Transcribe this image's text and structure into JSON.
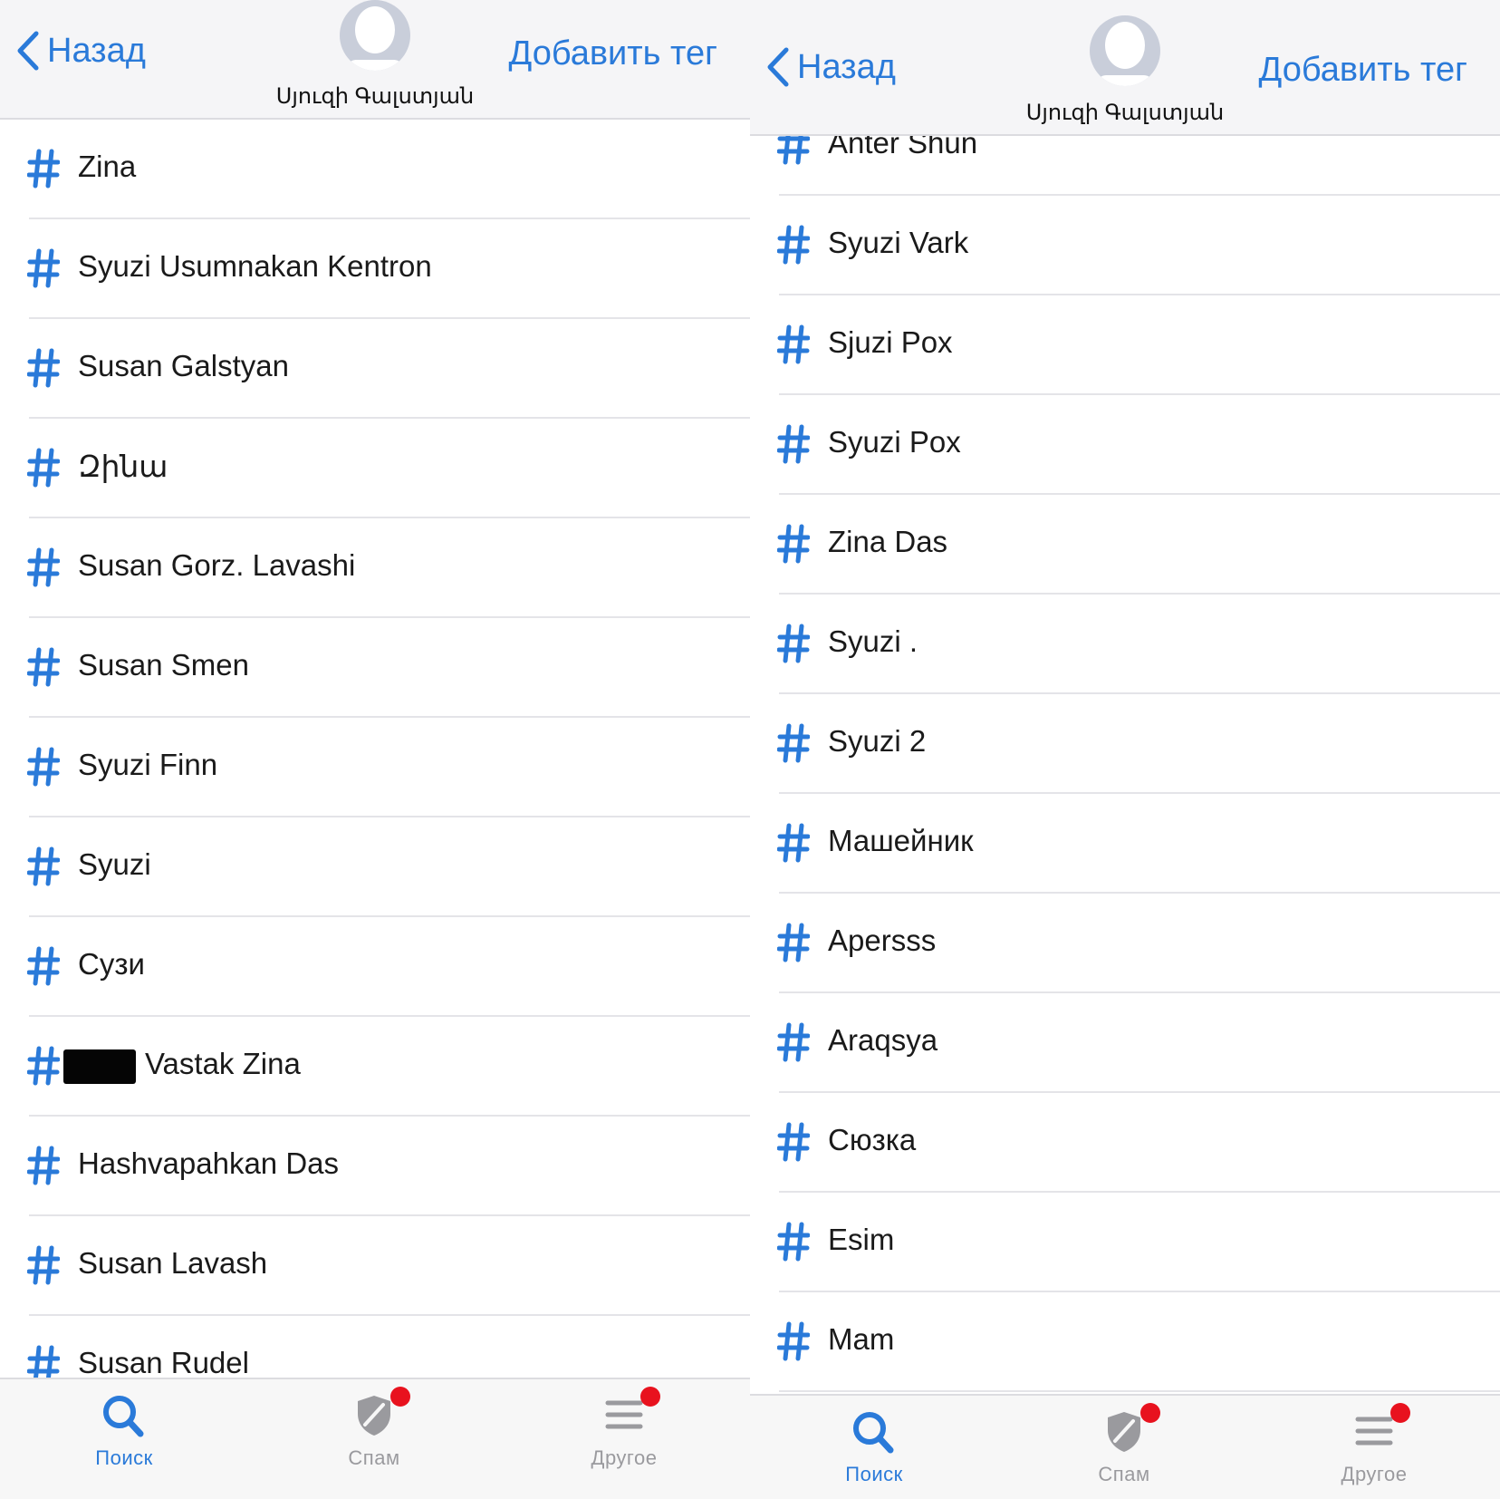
{
  "colors": {
    "accent": "#2a7ad9",
    "badge": "#e8121e",
    "header_bg": "#f5f5f7",
    "tabbar_bg": "#f7f7f7",
    "inactive": "#9a9a9e"
  },
  "screens": [
    {
      "header": {
        "back_label": "Назад",
        "contact_name": "Սյուզի Գալստյան",
        "add_tag_label": "Добавить тег"
      },
      "tags": [
        {
          "label": "Zina"
        },
        {
          "label": "Syuzi Usumnakan Kentron"
        },
        {
          "label": "Susan Galstyan"
        },
        {
          "label": "Զինա"
        },
        {
          "label": "Susan Gorz. Lavashi"
        },
        {
          "label": "Susan Smen"
        },
        {
          "label": "Syuzi Finn"
        },
        {
          "label": "Syuzi"
        },
        {
          "label": "Сузи"
        },
        {
          "label": "Vastak Zina",
          "redacted_prefix": true
        },
        {
          "label": "Hashvapahkan Das"
        },
        {
          "label": "Susan Lavash"
        },
        {
          "label": "Susan Rudel"
        }
      ],
      "tabbar": [
        {
          "label": "Поиск",
          "icon": "search-icon",
          "active": true,
          "badge": false
        },
        {
          "label": "Спам",
          "icon": "shield-icon",
          "active": false,
          "badge": true
        },
        {
          "label": "Другое",
          "icon": "menu-icon",
          "active": false,
          "badge": true
        }
      ]
    },
    {
      "header": {
        "back_label": "Назад",
        "contact_name": "Սյուզի Գալստյան",
        "add_tag_label": "Добавить тег"
      },
      "tags": [
        {
          "label": "Anter Shun"
        },
        {
          "label": "Syuzi Vark"
        },
        {
          "label": "Sjuzi Pox"
        },
        {
          "label": "Syuzi Pox"
        },
        {
          "label": "Zina Das"
        },
        {
          "label": "Syuzi ."
        },
        {
          "label": "Syuzi 2"
        },
        {
          "label": "Машейник"
        },
        {
          "label": "Apersss"
        },
        {
          "label": "Araqsya"
        },
        {
          "label": "Сюзка"
        },
        {
          "label": "Esim"
        },
        {
          "label": "Mam"
        }
      ],
      "tabbar": [
        {
          "label": "Поиск",
          "icon": "search-icon",
          "active": true,
          "badge": false
        },
        {
          "label": "Спам",
          "icon": "shield-icon",
          "active": false,
          "badge": true
        },
        {
          "label": "Другое",
          "icon": "menu-icon",
          "active": false,
          "badge": true
        }
      ]
    }
  ]
}
